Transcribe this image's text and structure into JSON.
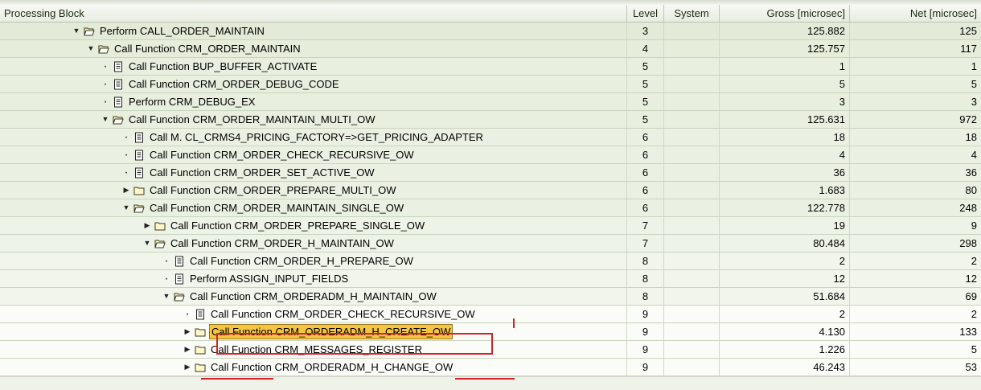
{
  "header": {
    "processing_block": "Processing Block",
    "level": "Level",
    "system": "System",
    "gross": "Gross [microsec]",
    "net": "Net [microsec]"
  },
  "rows": [
    {
      "indent": 88,
      "toggle": "expanded",
      "icon": "folder-open-icon",
      "label": "Perform CALL_ORDER_MAINTAIN",
      "level": "3",
      "system": "",
      "gross": "125.882",
      "net": "125"
    },
    {
      "indent": 106,
      "toggle": "expanded",
      "icon": "folder-open-icon",
      "label": "Call Function CRM_ORDER_MAINTAIN",
      "level": "4",
      "system": "",
      "gross": "125.757",
      "net": "117"
    },
    {
      "indent": 124,
      "toggle": "leaf",
      "icon": "document-icon",
      "label": "Call Function BUP_BUFFER_ACTIVATE",
      "level": "5",
      "system": "",
      "gross": "1",
      "net": "1"
    },
    {
      "indent": 124,
      "toggle": "leaf",
      "icon": "document-icon",
      "label": "Call Function CRM_ORDER_DEBUG_CODE",
      "level": "5",
      "system": "",
      "gross": "5",
      "net": "5"
    },
    {
      "indent": 124,
      "toggle": "leaf",
      "icon": "document-icon",
      "label": "Perform CRM_DEBUG_EX",
      "level": "5",
      "system": "",
      "gross": "3",
      "net": "3"
    },
    {
      "indent": 124,
      "toggle": "expanded",
      "icon": "folder-open-icon",
      "label": "Call Function CRM_ORDER_MAINTAIN_MULTI_OW",
      "level": "5",
      "system": "",
      "gross": "125.631",
      "net": "972"
    },
    {
      "indent": 150,
      "toggle": "leaf",
      "icon": "document-icon",
      "label": "Call M. CL_CRMS4_PRICING_FACTORY=>GET_PRICING_ADAPTER",
      "level": "6",
      "system": "",
      "gross": "18",
      "net": "18"
    },
    {
      "indent": 150,
      "toggle": "leaf",
      "icon": "document-icon",
      "label": "Call Function CRM_ORDER_CHECK_RECURSIVE_OW",
      "level": "6",
      "system": "",
      "gross": "4",
      "net": "4"
    },
    {
      "indent": 150,
      "toggle": "leaf",
      "icon": "document-icon",
      "label": "Call Function CRM_ORDER_SET_ACTIVE_OW",
      "level": "6",
      "system": "",
      "gross": "36",
      "net": "36"
    },
    {
      "indent": 150,
      "toggle": "collapsed",
      "icon": "folder-icon",
      "label": "Call Function CRM_ORDER_PREPARE_MULTI_OW",
      "level": "6",
      "system": "",
      "gross": "1.683",
      "net": "80"
    },
    {
      "indent": 150,
      "toggle": "expanded",
      "icon": "folder-open-icon",
      "label": "Call Function CRM_ORDER_MAINTAIN_SINGLE_OW",
      "level": "6",
      "system": "",
      "gross": "122.778",
      "net": "248"
    },
    {
      "indent": 176,
      "toggle": "collapsed",
      "icon": "folder-icon",
      "label": "Call Function CRM_ORDER_PREPARE_SINGLE_OW",
      "level": "7",
      "system": "",
      "gross": "19",
      "net": "9"
    },
    {
      "indent": 176,
      "toggle": "expanded",
      "icon": "folder-open-icon",
      "label": "Call Function CRM_ORDER_H_MAINTAIN_OW",
      "level": "7",
      "system": "",
      "gross": "80.484",
      "net": "298"
    },
    {
      "indent": 200,
      "toggle": "leaf",
      "icon": "document-icon",
      "label": "Call Function CRM_ORDER_H_PREPARE_OW",
      "level": "8",
      "system": "",
      "gross": "2",
      "net": "2"
    },
    {
      "indent": 200,
      "toggle": "leaf",
      "icon": "document-icon",
      "label": "Perform ASSIGN_INPUT_FIELDS",
      "level": "8",
      "system": "",
      "gross": "12",
      "net": "12"
    },
    {
      "indent": 200,
      "toggle": "expanded",
      "icon": "folder-open-icon",
      "label": "Call Function CRM_ORDERADM_H_MAINTAIN_OW",
      "level": "8",
      "system": "",
      "gross": "51.684",
      "net": "69"
    },
    {
      "indent": 226,
      "toggle": "leaf",
      "icon": "document-icon",
      "label": "Call Function CRM_ORDER_CHECK_RECURSIVE_OW",
      "level": "9",
      "system": "",
      "gross": "2",
      "net": "2"
    },
    {
      "indent": 226,
      "toggle": "collapsed",
      "icon": "folder-icon",
      "label": "Call Function CRM_ORDERADM_H_CREATE_OW",
      "level": "9",
      "system": "",
      "gross": "4.130",
      "net": "133",
      "selected": true
    },
    {
      "indent": 226,
      "toggle": "collapsed",
      "icon": "folder-icon",
      "label": "Call Function CRM_MESSAGES_REGISTER",
      "level": "9",
      "system": "",
      "gross": "1.226",
      "net": "5"
    },
    {
      "indent": 226,
      "toggle": "collapsed",
      "icon": "folder-icon",
      "label": "Call Function CRM_ORDERADM_H_CHANGE_OW",
      "level": "9",
      "system": "",
      "gross": "46.243",
      "net": "53"
    }
  ],
  "colors": {
    "highlight": "#f5c542",
    "annotation_red": "#d2232a"
  }
}
